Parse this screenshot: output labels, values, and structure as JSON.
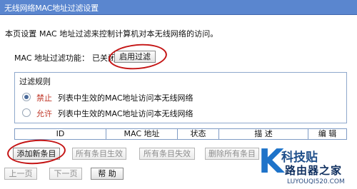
{
  "window": {
    "title": "无线网络MAC地址过滤设置"
  },
  "intro": "本页设置 MAC 地址过滤来控制计算机对本无线网络的访问。",
  "filter_function": {
    "label": "MAC 地址过滤功能：",
    "status": "已关闭",
    "enable_button": "启用过滤"
  },
  "rules": {
    "title": "过滤规则",
    "options": [
      {
        "key": "禁止",
        "desc": "列表中生效的MAC地址访问本无线网络",
        "checked": true
      },
      {
        "key": "允许",
        "desc": "列表中生效的MAC地址访问本无线网络",
        "checked": false
      }
    ]
  },
  "table": {
    "headers": [
      "ID",
      "MAC 地址",
      "状态",
      "描 述",
      "编 辑"
    ]
  },
  "buttons": {
    "add_new": "添加新条目",
    "enable_all": "所有条目生效",
    "disable_all": "所有条目失效",
    "delete_all": "删除所有条目",
    "prev_page": "上一页",
    "next_page": "下一页",
    "help": "帮 助"
  },
  "watermark": {
    "letter": "K",
    "line1": "科技贴",
    "line2": "路由器之家",
    "url": "LUYOUQI520.COM"
  },
  "colors": {
    "title_bar": "#5a86cf",
    "annotation": "#c41414",
    "option_key": "#c0392b"
  }
}
